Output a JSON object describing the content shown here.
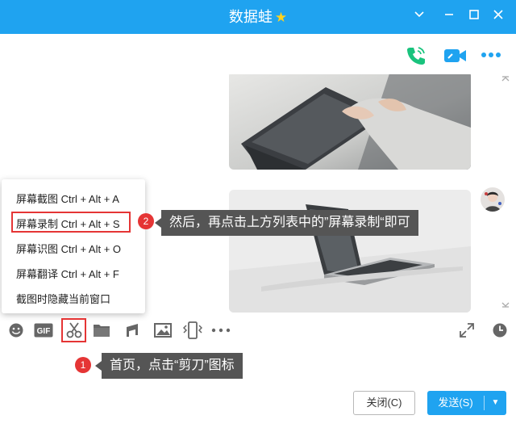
{
  "window": {
    "title": "数据蛙",
    "title_star": "★",
    "minimize_icon": "chevron-down",
    "colors": {
      "titlebar": "#1fa3f0",
      "accent_red": "#e53535",
      "callout_bg": "#555555",
      "phone_green": "#19c37d"
    }
  },
  "screenshot_menu": {
    "items": [
      {
        "label": "屏幕截图 Ctrl + Alt + A"
      },
      {
        "label": "屏幕录制 Ctrl + Alt + S",
        "highlighted": true
      },
      {
        "label": "屏幕识图 Ctrl + Alt + O"
      },
      {
        "label": "屏幕翻译 Ctrl + Alt + F"
      },
      {
        "label": "截图时隐藏当前窗口"
      }
    ]
  },
  "annotations": {
    "step1": {
      "number": "1",
      "text": "首页，点击“剪刀”图标"
    },
    "step2": {
      "number": "2",
      "text": "然后，再点击上方列表中的”屏幕录制“即可"
    }
  },
  "buttons": {
    "close_label": "关闭(C)",
    "send_label": "发送(S)",
    "send_dropdown": "▼"
  }
}
